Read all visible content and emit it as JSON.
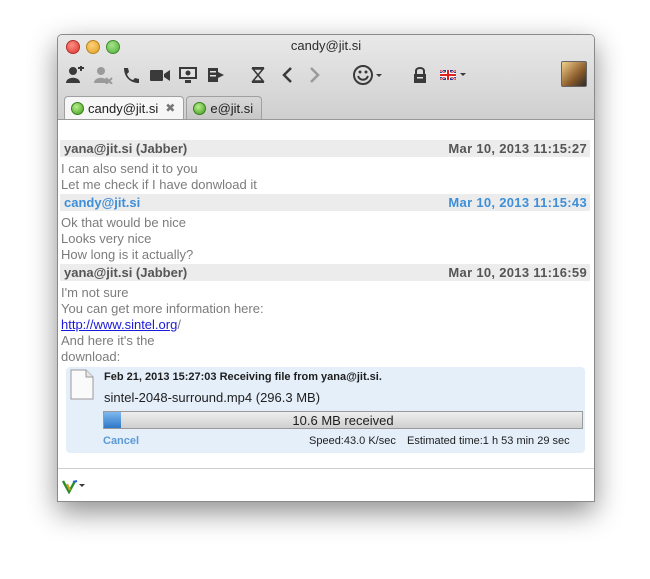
{
  "window": {
    "title": "candy@jit.si"
  },
  "toolbar": {
    "icons": [
      "add-contact-icon",
      "remove-contact-icon",
      "phone-icon",
      "video-camera-icon",
      "share-desktop-icon",
      "send-file-icon",
      "history-icon",
      "back-arrow-icon",
      "forward-arrow-icon",
      "smiley-icon",
      "lock-icon",
      "language-flag-icon"
    ]
  },
  "tabs": [
    {
      "label": "candy@jit.si",
      "active": true,
      "closable": true,
      "close_glyph": "✖"
    },
    {
      "label": "e@jit.si",
      "active": false,
      "closable": false
    }
  ],
  "messages": [
    {
      "sender": "yana@jit.si (Jabber)",
      "time": "Mar 10, 2013 11:15:27",
      "self": false,
      "lines": [
        "I can also send it to you",
        "Let me check if I have donwload it"
      ]
    },
    {
      "sender": "candy@jit.si",
      "time": "Mar 10, 2013 11:15:43",
      "self": true,
      "lines": [
        "Ok that would be nice",
        "Looks very nice",
        "How long is it actually?"
      ]
    },
    {
      "sender": "yana@jit.si (Jabber)",
      "time": "Mar 10, 2013 11:16:59",
      "self": false,
      "lines": [
        "I'm not sure",
        "You can get more information here:",
        "",
        "And here it's the",
        "download:"
      ],
      "link": {
        "text": "http://www.sintel.org",
        "suffix": "/"
      }
    }
  ],
  "file_transfer": {
    "header": "Feb 21, 2013 15:27:03 Receiving file from yana@jit.si.",
    "filename": "sintel-2048-surround.mp4 (296.3 MB)",
    "progress_text": "10.6 MB received",
    "progress_fraction": 0.036,
    "cancel_label": "Cancel",
    "speed": "Speed:43.0 K/sec",
    "eta": "Estimated time:1 h 53 min 29 sec"
  },
  "colors": {
    "self_sender": "#3f8fd8",
    "other_sender": "#555555",
    "link": "#1a1ad8",
    "transfer_bg": "#e5effa"
  }
}
